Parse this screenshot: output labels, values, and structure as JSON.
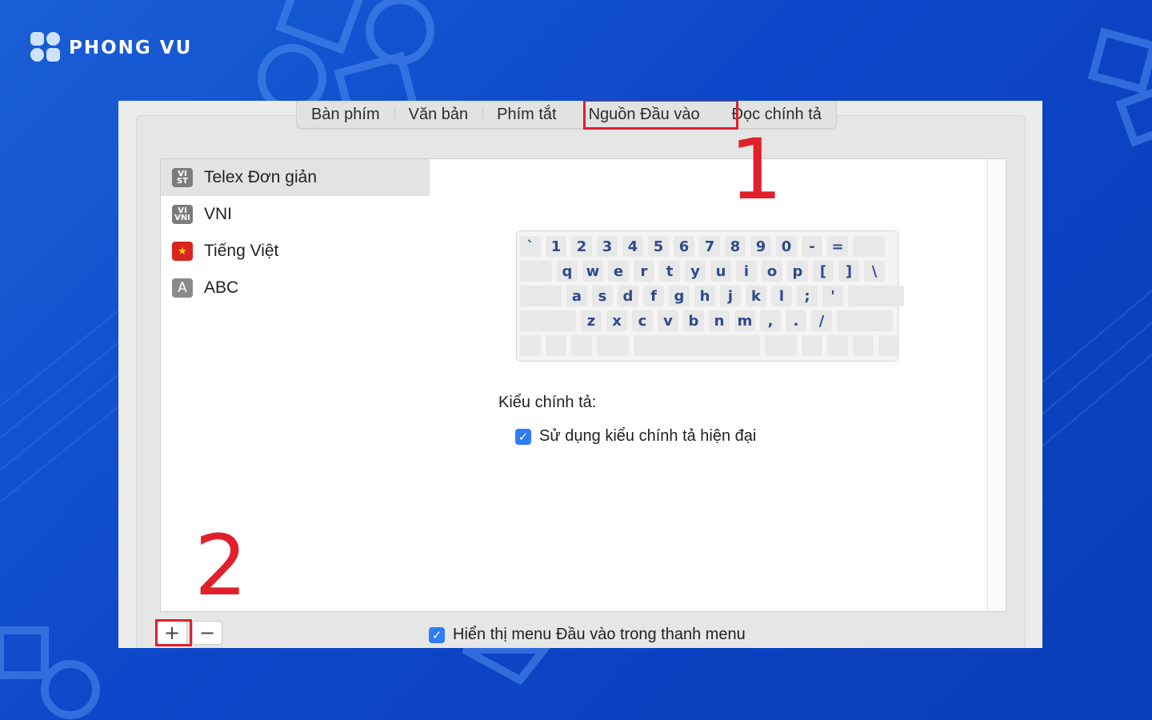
{
  "brand": {
    "name": "PHONG VU"
  },
  "tabs": [
    {
      "label": "Bàn phím",
      "selected": false
    },
    {
      "label": "Văn bản",
      "selected": false
    },
    {
      "label": "Phím tắt",
      "selected": false
    },
    {
      "label": "Nguồn Đầu vào",
      "selected": true
    },
    {
      "label": "Đọc chính tả",
      "selected": false
    }
  ],
  "input_sources": [
    {
      "label": "Telex Đơn giản",
      "icon": "vi-st-icon",
      "icon_text": "VI ST",
      "selected": true
    },
    {
      "label": "VNI",
      "icon": "vi-vni-icon",
      "icon_text": "VI VNI",
      "selected": false
    },
    {
      "label": "Tiếng Việt",
      "icon": "vietnam-flag-icon",
      "icon_text": "",
      "selected": false
    },
    {
      "label": "ABC",
      "icon": "letter-a-icon",
      "icon_text": "A",
      "selected": false
    }
  ],
  "list_buttons": {
    "add": "+",
    "remove": "−"
  },
  "keyboard": {
    "row1": [
      "`",
      "1",
      "2",
      "3",
      "4",
      "5",
      "6",
      "7",
      "8",
      "9",
      "0",
      "-",
      "="
    ],
    "row2": [
      "q",
      "w",
      "e",
      "r",
      "t",
      "y",
      "u",
      "i",
      "o",
      "p",
      "[",
      "]",
      "\\"
    ],
    "row3": [
      "a",
      "s",
      "d",
      "f",
      "g",
      "h",
      "j",
      "k",
      "l",
      ";",
      "'"
    ],
    "row4": [
      "z",
      "x",
      "c",
      "v",
      "b",
      "n",
      "m",
      ",",
      ".",
      "/"
    ]
  },
  "spelling": {
    "label": "Kiểu chính tả:",
    "modern_checkbox_label": "Sử dụng kiểu chính tả hiện đại",
    "modern_checked": true
  },
  "menu_checkbox": {
    "label": "Hiển thị menu Đầu vào trong thanh menu",
    "checked": true
  },
  "annotations": {
    "step1": "1",
    "step2": "2"
  },
  "colors": {
    "background": "#0d47c9",
    "highlight": "#e0202a",
    "checkbox": "#2f7cf6",
    "key_text": "#2f4b8a"
  }
}
